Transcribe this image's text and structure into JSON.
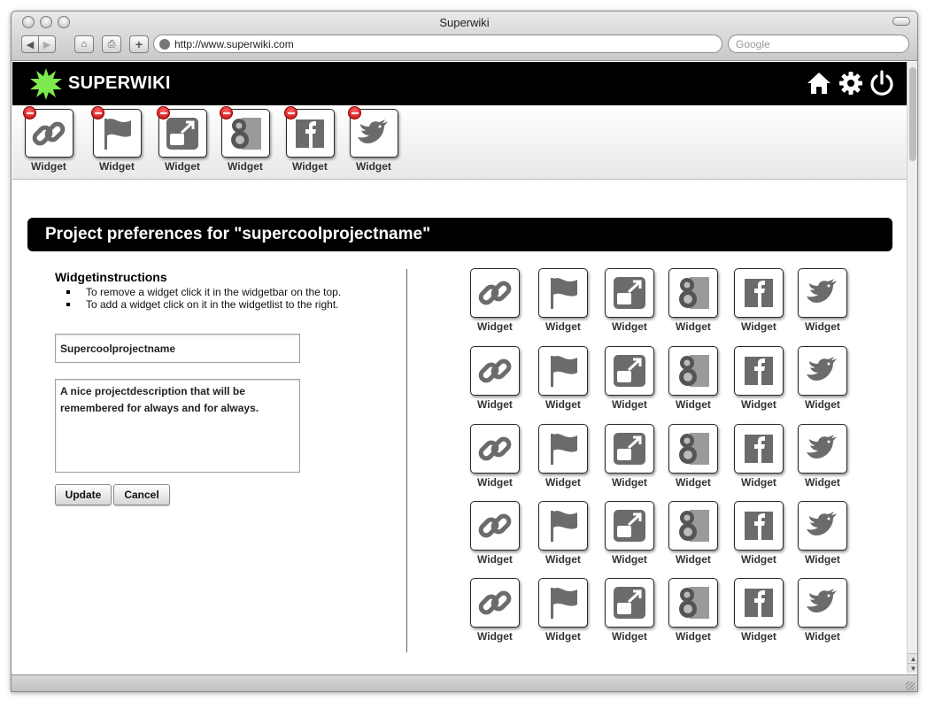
{
  "browser": {
    "window_title": "Superwiki",
    "url": "http://www.superwiki.com",
    "search_placeholder": "Google"
  },
  "app": {
    "brand": "SUPERWIKI",
    "brand_color": "#7ee84f",
    "header_icons": [
      "home-icon",
      "gear-icon",
      "power-icon"
    ]
  },
  "widgetbar": {
    "items": [
      {
        "label": "Widget",
        "icon": "link-icon"
      },
      {
        "label": "Widget",
        "icon": "flag-icon"
      },
      {
        "label": "Widget",
        "icon": "external-window-icon"
      },
      {
        "label": "Widget",
        "icon": "google-icon"
      },
      {
        "label": "Widget",
        "icon": "facebook-icon"
      },
      {
        "label": "Widget",
        "icon": "twitter-bird-icon"
      }
    ]
  },
  "prefs": {
    "title": "Project preferences for \"supercoolprojectname\"",
    "instructions_title": "Widgetinstructions",
    "instructions": [
      "To remove a widget click it in the widgetbar on the top.",
      "To add a widget click on it in the widgetlist to the right."
    ],
    "name_value": "Supercoolprojectname",
    "description_value": "A nice projectdescription that will be remembered for always and for always.",
    "update_label": "Update",
    "cancel_label": "Cancel"
  },
  "widget_list": {
    "label": "Widget",
    "icons": [
      "link-icon",
      "flag-icon",
      "external-window-icon",
      "google-icon",
      "facebook-icon",
      "twitter-bird-icon"
    ],
    "rows": 5
  }
}
